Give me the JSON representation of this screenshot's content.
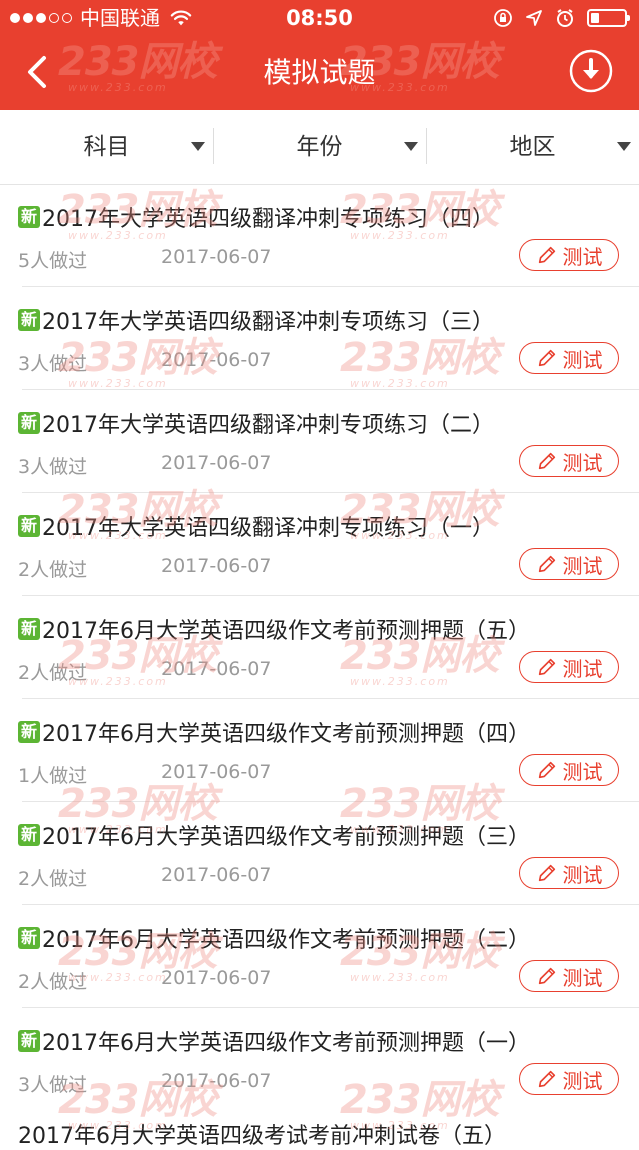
{
  "status": {
    "carrier": "中国联通",
    "time": "08:50",
    "signal_filled": 3,
    "signal_total": 5,
    "battery_level": 0.25
  },
  "nav": {
    "title": "模拟试题"
  },
  "filters": [
    "科目",
    "年份",
    "地区"
  ],
  "watermark": {
    "brand": "233网校",
    "site": "www.233.com"
  },
  "colors": {
    "accent": "#e8402f",
    "badge": "#5cb534",
    "meta": "#9a9a9a"
  },
  "new_badge_label": "新",
  "test_button_label": "测试",
  "items": [
    {
      "title": "2017年大学英语四级翻译冲刺专项练习（四）",
      "done": "5人做过",
      "date": "2017-06-07"
    },
    {
      "title": "2017年大学英语四级翻译冲刺专项练习（三）",
      "done": "3人做过",
      "date": "2017-06-07"
    },
    {
      "title": "2017年大学英语四级翻译冲刺专项练习（二）",
      "done": "3人做过",
      "date": "2017-06-07"
    },
    {
      "title": "2017年大学英语四级翻译冲刺专项练习（一）",
      "done": "2人做过",
      "date": "2017-06-07"
    },
    {
      "title": "2017年6月大学英语四级作文考前预测押题（五）",
      "done": "2人做过",
      "date": "2017-06-07"
    },
    {
      "title": "2017年6月大学英语四级作文考前预测押题（四）",
      "done": "1人做过",
      "date": "2017-06-07"
    },
    {
      "title": "2017年6月大学英语四级作文考前预测押题（三）",
      "done": "2人做过",
      "date": "2017-06-07"
    },
    {
      "title": "2017年6月大学英语四级作文考前预测押题（二）",
      "done": "2人做过",
      "date": "2017-06-07"
    },
    {
      "title": "2017年6月大学英语四级作文考前预测押题（一）",
      "done": "3人做过",
      "date": "2017-06-07"
    }
  ],
  "partial_item_title": "2017年6月大学英语四级考试考前冲刺试卷（五）"
}
